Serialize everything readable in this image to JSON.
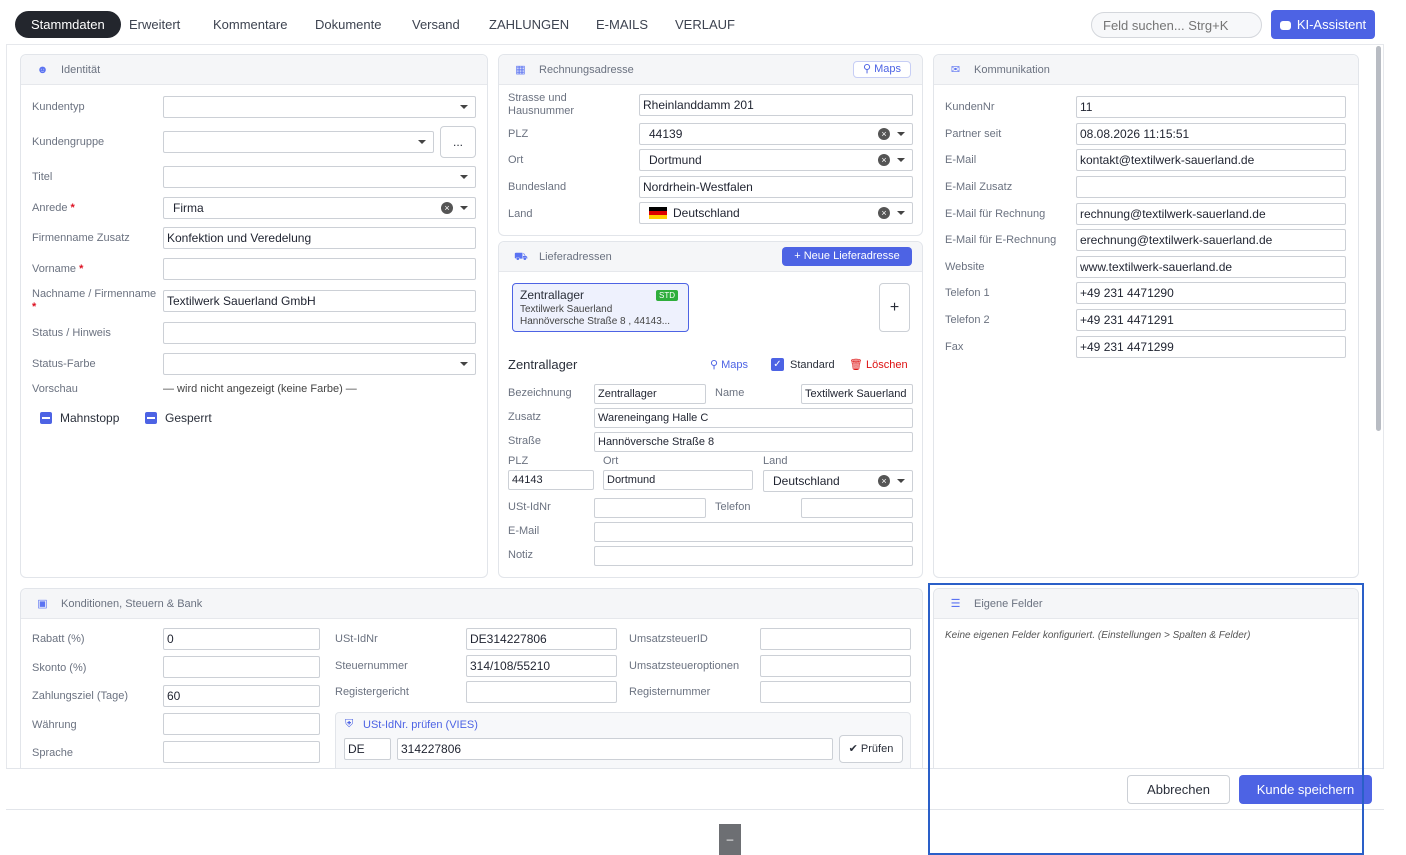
{
  "tabs": [
    "Stammdaten",
    "Erweitert",
    "Kommentare",
    "Dokumente",
    "Versand",
    "ZAHLUNGEN",
    "E-MAILS",
    "VERLAUF"
  ],
  "search": {
    "placeholder": "Feld suchen... Strg+K"
  },
  "ai_button": "KI-Assistent",
  "identity": {
    "title": "Identität",
    "labels": {
      "kundentyp": "Kundentyp",
      "kundengruppe": "Kundengruppe",
      "titel": "Titel",
      "anrede": "Anrede",
      "firmenname_zusatz": "Firmenname Zusatz",
      "vorname": "Vorname",
      "nachname": "Nachname / Firmenname",
      "status_hinweis": "Status / Hinweis",
      "status_farbe": "Status-Farbe",
      "vorschau": "Vorschau"
    },
    "values": {
      "kundentyp": "",
      "kundengruppe": "",
      "titel": "",
      "anrede": "Firma",
      "firmenname_zusatz": "Konfektion und Veredelung",
      "vorname": "",
      "nachname": "Textilwerk Sauerland GmbH",
      "status_hinweis": "",
      "status_farbe": ""
    },
    "required_mark": "*",
    "ellipsis_button": "...",
    "vorschau_text": "— wird nicht angezeigt (keine Farbe) —",
    "mahnstopp": "Mahnstopp",
    "gesperrt": "Gesperrt"
  },
  "billing": {
    "title": "Rechnungsadresse",
    "maps": "Maps",
    "labels": {
      "strasse": "Strasse und Hausnummer",
      "plz": "PLZ",
      "ort": "Ort",
      "bundesland": "Bundesland",
      "land": "Land"
    },
    "values": {
      "strasse": "Rheinlanddamm 201",
      "plz": "44139",
      "ort": "Dortmund",
      "bundesland": "Nordrhein-Westfalen",
      "land": "Deutschland"
    }
  },
  "delivery": {
    "title": "Lieferadressen",
    "new_button": "Neue Lieferadresse",
    "card": {
      "name": "Zentrallager",
      "badge": "STD",
      "line1": "Textilwerk Sauerland",
      "line2": "Hannöversche Straße 8 ,  44143..."
    },
    "add": "+",
    "detail_title": "Zentrallager",
    "maps": "Maps",
    "standard": "Standard",
    "delete": "Löschen",
    "labels": {
      "bezeichnung": "Bezeichnung",
      "name": "Name",
      "zusatz": "Zusatz",
      "strasse": "Straße",
      "plz": "PLZ",
      "ort": "Ort",
      "land": "Land",
      "ustid": "USt-IdNr",
      "telefon": "Telefon",
      "email": "E-Mail",
      "notiz": "Notiz"
    },
    "values": {
      "bezeichnung": "Zentrallager",
      "name": "Textilwerk Sauerland",
      "zusatz": "Wareneingang Halle C",
      "strasse": "Hannöversche Straße 8",
      "plz": "44143",
      "ort": "Dortmund",
      "land": "Deutschland",
      "ustid": "",
      "telefon": "",
      "email": "",
      "notiz": ""
    }
  },
  "communication": {
    "title": "Kommunikation",
    "labels": {
      "kundennr": "KundenNr",
      "partner": "Partner seit",
      "email": "E-Mail",
      "email_zusatz": "E-Mail Zusatz",
      "email_rechnung": "E-Mail für Rechnung",
      "email_erechnung": "E-Mail für E-Rechnung",
      "website": "Website",
      "tel1": "Telefon 1",
      "tel2": "Telefon 2",
      "fax": "Fax"
    },
    "values": {
      "kundennr": "11",
      "partner": "08.08.2026 11:15:51",
      "email": "kontakt@textilwerk-sauerland.de",
      "email_zusatz": "",
      "email_rechnung": "rechnung@textilwerk-sauerland.de",
      "email_erechnung": "erechnung@textilwerk-sauerland.de",
      "website": "www.textilwerk-sauerland.de",
      "tel1": "+49 231 4471290",
      "tel2": "+49 231 4471291",
      "fax": "+49 231 4471299"
    }
  },
  "conditions": {
    "title": "Konditionen, Steuern & Bank",
    "labels": {
      "rabatt": "Rabatt (%)",
      "skonto": "Skonto (%)",
      "zahlungsziel": "Zahlungsziel (Tage)",
      "waehrung": "Währung",
      "sprache": "Sprache",
      "ustid": "USt-IdNr",
      "steuernummer": "Steuernummer",
      "registergericht": "Registergericht",
      "umsatzsteuerid": "UmsatzsteuerID",
      "umsatzsteueroptionen": "Umsatzsteueroptionen",
      "registernummer": "Registernummer"
    },
    "values": {
      "rabatt": "0",
      "skonto": "",
      "zahlungsziel": "60",
      "waehrung": "",
      "sprache": "",
      "ustid": "DE314227806",
      "steuernummer": "314/108/55210",
      "registergericht": "",
      "umsatzsteuerid": "",
      "umsatzsteueroptionen": "",
      "registernummer": ""
    },
    "vies": {
      "title": "USt-IdNr. prüfen (VIES)",
      "country": "DE",
      "number": "314227806",
      "button": "Prüfen"
    }
  },
  "custom": {
    "title": "Eigene Felder",
    "empty": "Keine eigenen Felder konfiguriert. (Einstellungen > Spalten & Felder)"
  },
  "footer": {
    "cancel": "Abbrechen",
    "save": "Kunde speichern",
    "handle": "–"
  }
}
